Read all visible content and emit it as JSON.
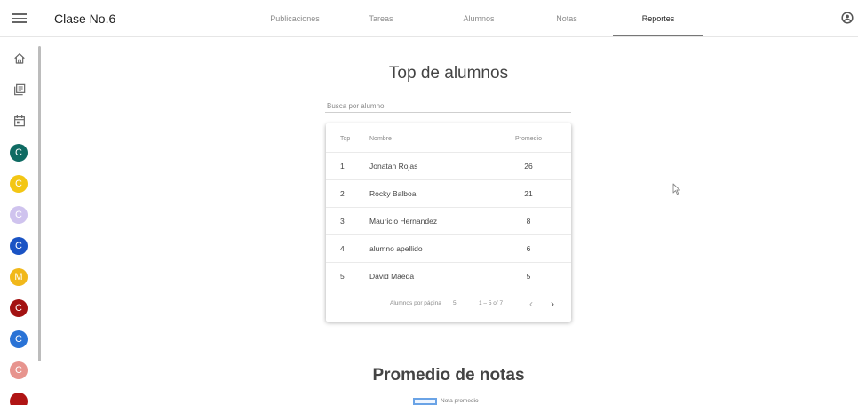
{
  "app": {
    "class_title": "Clase No.6"
  },
  "tabs": [
    {
      "label": "Publicaciones",
      "active": false
    },
    {
      "label": "Tareas",
      "active": false
    },
    {
      "label": "Alumnos",
      "active": false
    },
    {
      "label": "Notas",
      "active": false
    },
    {
      "label": "Reportes",
      "active": true
    }
  ],
  "rail": {
    "icons": [
      "home-icon",
      "library-icon",
      "calendar-icon"
    ],
    "avatars": [
      {
        "letter": "C",
        "color": "#0f6b63"
      },
      {
        "letter": "C",
        "color": "#f3c614"
      },
      {
        "letter": "C",
        "color": "#cfc3ee"
      },
      {
        "letter": "C",
        "color": "#1a53c4"
      },
      {
        "letter": "M",
        "color": "#f1b81a"
      },
      {
        "letter": "C",
        "color": "#a31212"
      },
      {
        "letter": "C",
        "color": "#2a73d6"
      },
      {
        "letter": "C",
        "color": "#e7948e"
      },
      {
        "letter": "",
        "color": "#b01414"
      }
    ]
  },
  "report": {
    "title": "Top de alumnos",
    "search_placeholder": "Busca por alumno",
    "table": {
      "headers": {
        "top": "Top",
        "name": "Nombre",
        "avg": "Promedio"
      },
      "rows": [
        {
          "top": "1",
          "name": "Jonatan Rojas",
          "avg": "26"
        },
        {
          "top": "2",
          "name": "Rocky Balboa",
          "avg": "21"
        },
        {
          "top": "3",
          "name": "Mauricio Hernandez",
          "avg": "8"
        },
        {
          "top": "4",
          "name": "alumno apellido",
          "avg": "6"
        },
        {
          "top": "5",
          "name": "David Maeda",
          "avg": "5"
        }
      ]
    },
    "pagination": {
      "per_page_label": "Alumnos por página",
      "per_page_value": "5",
      "range": "1 – 5 of 7",
      "prev": "‹",
      "next": "›"
    }
  },
  "grades": {
    "title": "Promedio de notas",
    "legend_label": "Nota promedio"
  },
  "colors": {
    "legend_stroke": "#6aa3e6",
    "tab_underline": "#777777"
  }
}
